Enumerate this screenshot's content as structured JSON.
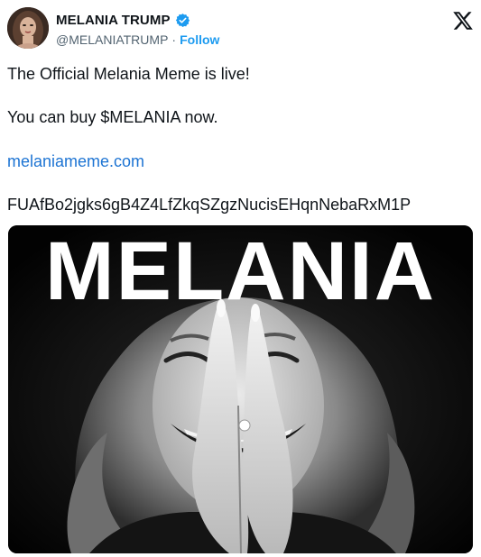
{
  "author": {
    "display_name": "MELANIA TRUMP",
    "handle": "@MELANIATRUMP",
    "separator": "·",
    "follow_label": "Follow",
    "verified": true
  },
  "tweet": {
    "line1": "The Official Melania Meme is live!",
    "line2": "You can buy $MELANIA now.",
    "link": "melaniameme.com",
    "address": "FUAfBo2jgks6gB4Z4LfZkqSZgzNucisEHqnNebaRxM1P"
  },
  "media": {
    "title": "MELANIA",
    "description_icon": "black-and-white-portrait"
  },
  "icons": {
    "brand": "x-logo-icon",
    "verified": "verified-badge-icon"
  },
  "colors": {
    "link": "#1d74d3",
    "follow": "#1d9bf0",
    "verified": "#1d9bf0",
    "text": "#0f1419",
    "muted": "#536471"
  }
}
